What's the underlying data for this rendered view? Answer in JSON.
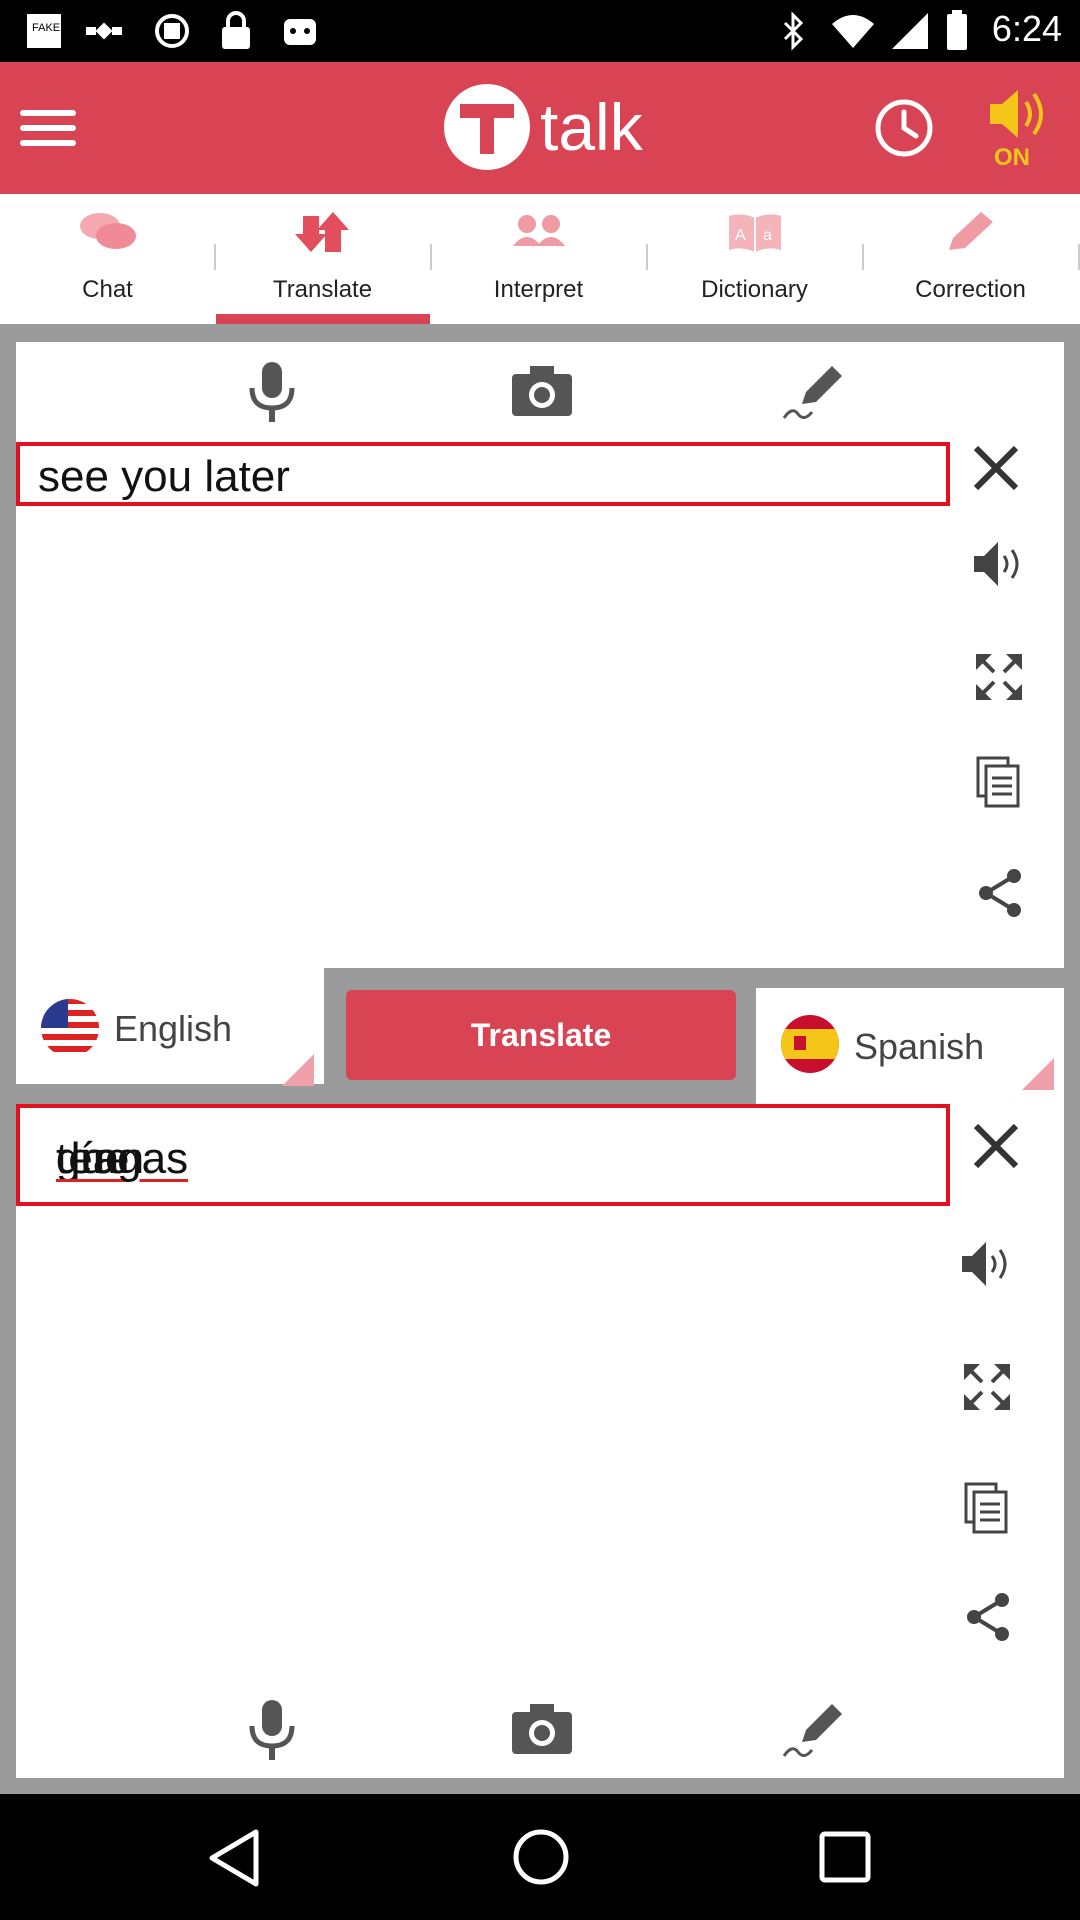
{
  "status_bar": {
    "time": "6:24",
    "icons": [
      "fake-gps-icon",
      "satellite-icon",
      "block-icon",
      "lock-icon",
      "android-icon",
      "bluetooth-icon",
      "wifi-icon",
      "signal-icon",
      "battery-icon"
    ]
  },
  "header": {
    "app_name": "talk",
    "sound_state": "ON",
    "brand_color": "#d84454"
  },
  "tabs": [
    {
      "label": "Chat",
      "icon": "chat-bubbles-icon"
    },
    {
      "label": "Translate",
      "icon": "swap-arrows-icon",
      "active": true
    },
    {
      "label": "Interpret",
      "icon": "people-icon"
    },
    {
      "label": "Dictionary",
      "icon": "book-icon"
    },
    {
      "label": "Correction",
      "icon": "pencil-icon"
    }
  ],
  "source": {
    "text": "see you later",
    "language": "English"
  },
  "target": {
    "text_words": [
      "que",
      "tengas",
      "un",
      "gran",
      "día"
    ],
    "language": "Spanish"
  },
  "translate_button": "Translate"
}
